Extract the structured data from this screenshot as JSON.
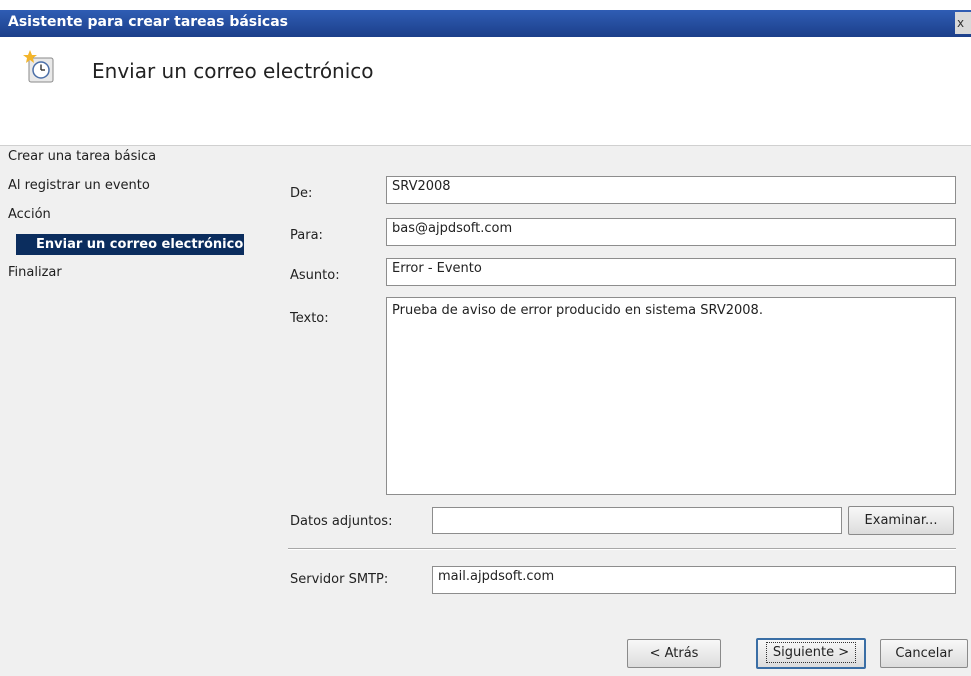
{
  "window": {
    "title": "Asistente para crear tareas básicas",
    "close_glyph": "x"
  },
  "header": {
    "icon": "task-scheduler-icon",
    "title": "Enviar un correo electrónico"
  },
  "nav": {
    "items": [
      {
        "label": "Crear una tarea básica",
        "selected": false
      },
      {
        "label": "Al registrar un evento",
        "selected": false
      },
      {
        "label": "Acción",
        "selected": false
      },
      {
        "label": "Enviar un correo electrónico",
        "selected": true
      },
      {
        "label": "Finalizar",
        "selected": false
      }
    ],
    "selected_color": "#0b2d5e"
  },
  "form": {
    "de": {
      "label": "De:",
      "value": "SRV2008"
    },
    "para": {
      "label": "Para:",
      "value": "bas@ajpdsoft.com"
    },
    "asunto": {
      "label": "Asunto:",
      "value": "Error - Evento"
    },
    "texto": {
      "label": "Texto:",
      "value": "Prueba de aviso de error producido en sistema SRV2008."
    },
    "adjuntos": {
      "label": "Datos adjuntos:",
      "value": "",
      "browse_label": "Examinar..."
    },
    "smtp": {
      "label": "Servidor SMTP:",
      "value": "mail.ajpdsoft.com"
    }
  },
  "buttons": {
    "back": "< Atrás",
    "next": "Siguiente >",
    "cancel": "Cancelar"
  }
}
